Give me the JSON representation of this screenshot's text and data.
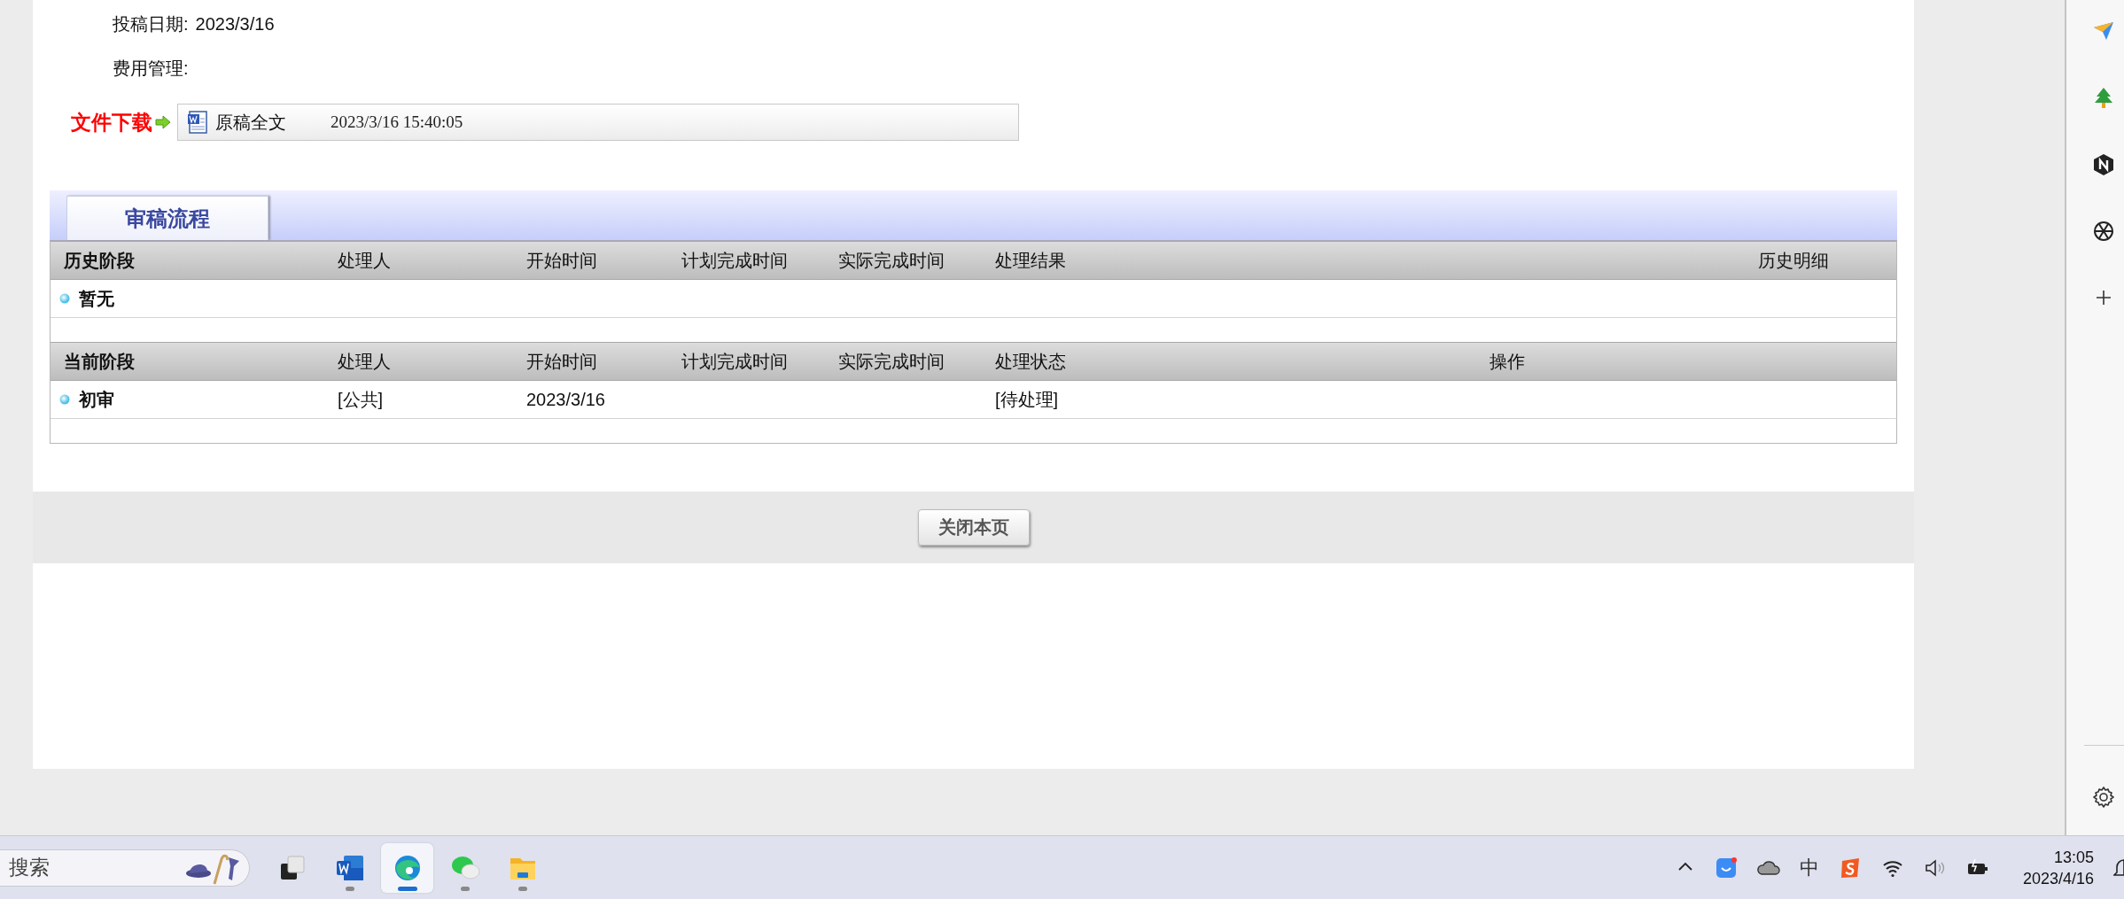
{
  "manuscript": {
    "fields": [
      {
        "label": "投稿日期:",
        "value": "2023/3/16"
      },
      {
        "label": "费用管理:"
      }
    ],
    "download": {
      "label": "文件下载",
      "file": {
        "name": "原稿全文",
        "time": "2023/3/16 15:40:05"
      }
    }
  },
  "tabs": [
    {
      "label": "审稿流程",
      "selected": true
    }
  ],
  "sections": [
    {
      "kind": "history",
      "headers": [
        "历史阶段",
        "处理人",
        "开始时间",
        "计划完成时间",
        "实际完成时间",
        "处理结果",
        "历史明细"
      ],
      "rows": [
        {
          "stage": "暂无"
        }
      ]
    },
    {
      "kind": "current",
      "headers": [
        "当前阶段",
        "处理人",
        "开始时间",
        "计划完成时间",
        "实际完成时间",
        "处理状态",
        "操作"
      ],
      "rows": [
        {
          "stage": "初审",
          "handler": "[公共]",
          "start_time": "2023/3/16",
          "status": "[待处理]"
        }
      ]
    }
  ],
  "close_button": "关闭本页",
  "sidebar": {
    "items": [
      {
        "kind": "send"
      },
      {
        "kind": "tree"
      },
      {
        "kind": "n"
      },
      {
        "kind": "openai"
      },
      {
        "kind": "add"
      }
    ],
    "settings": true
  },
  "taskbar": {
    "search": {
      "placeholder": "搜索"
    },
    "apps": [
      {
        "kind": "taskview",
        "running": false,
        "active": false
      },
      {
        "kind": "word",
        "running": true,
        "active": false
      },
      {
        "kind": "edge",
        "running": true,
        "active": true
      },
      {
        "kind": "wechat",
        "running": true,
        "active": false
      },
      {
        "kind": "explorer",
        "running": true,
        "active": false
      }
    ],
    "tray": [
      {
        "kind": "chevron"
      },
      {
        "kind": "face"
      },
      {
        "kind": "cloud"
      },
      {
        "kind": "ime",
        "text": "中"
      },
      {
        "kind": "sogou"
      },
      {
        "kind": "wifi"
      },
      {
        "kind": "speaker"
      },
      {
        "kind": "battery"
      }
    ],
    "time": "13:05",
    "date": "2023/4/16"
  }
}
